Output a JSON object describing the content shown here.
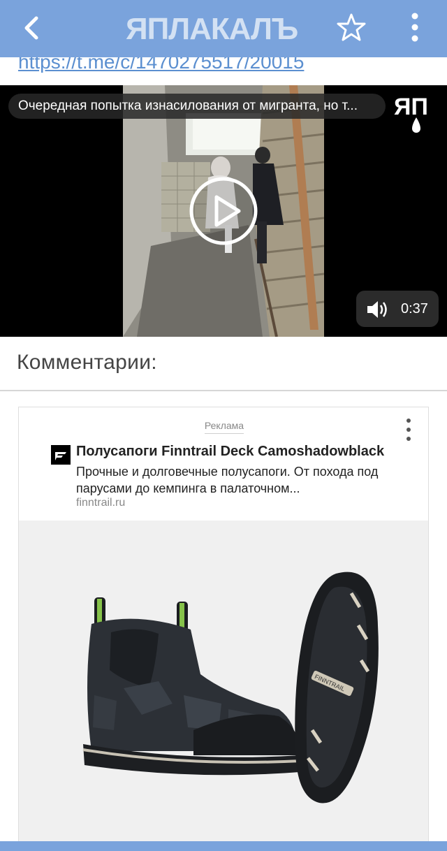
{
  "header": {
    "back_icon": "chevron-left-icon",
    "logo_text": "ЯПЛАКАЛЪ",
    "favorite_icon": "star-outline-icon",
    "menu_icon": "kebab-menu-icon",
    "bar_color": "#7aa3dc"
  },
  "post": {
    "link_text": "https://t.me/c/1470275517/20015"
  },
  "video": {
    "caption": "Очередная попытка изнасилования от мигранта, но т...",
    "channel_logo_text": "ЯП",
    "play_icon": "play-circle-icon",
    "volume_icon": "volume-icon",
    "duration": "0:37"
  },
  "comments": {
    "heading": "Комментарии:"
  },
  "ad": {
    "label": "Реклама",
    "menu_icon": "kebab-menu-icon",
    "favicon_icon": "finntrail-logo-icon",
    "title": "Полусапоги Finntrail Deck Camoshadowblack",
    "description": "Прочные и долговечные полусапоги. От похода под парусами до кемпинга в палаточном...",
    "domain": "finntrail.ru",
    "image_alt": "boot-image",
    "sole_brand": "FINNTRAIL",
    "boot_brand": "FINNTRAIL"
  }
}
